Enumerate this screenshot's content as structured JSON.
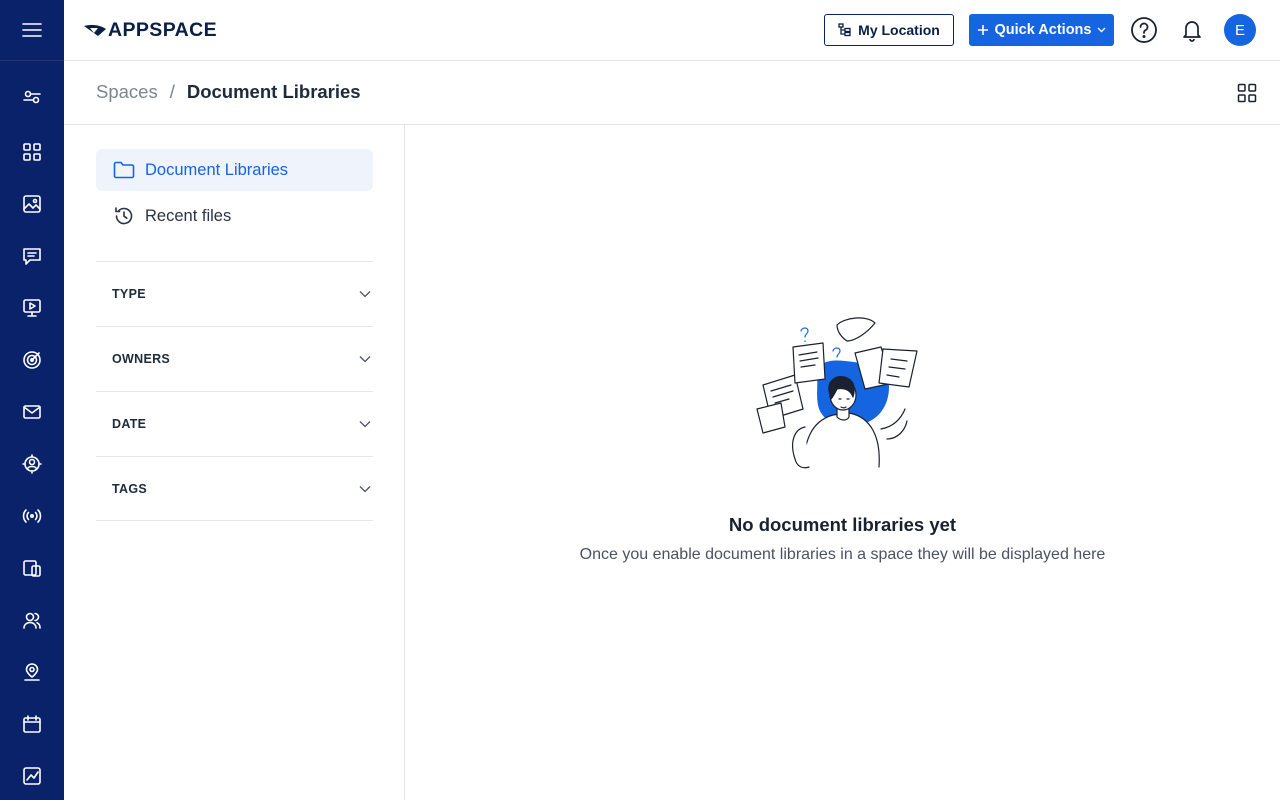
{
  "header": {
    "logo_text": "APPSPACE",
    "my_location_label": "My Location",
    "quick_actions_label": "Quick Actions",
    "avatar_initial": "E"
  },
  "rail": {
    "items": [
      "menu-icon",
      "filters-icon",
      "dashboard-grid-icon",
      "image-icon",
      "messages-icon",
      "display-icon",
      "target-icon",
      "mail-icon",
      "person-location-icon",
      "broadcast-icon",
      "devices-icon",
      "users-icon",
      "map-pin-user-icon",
      "calendar-icon",
      "analytics-icon"
    ]
  },
  "breadcrumb": {
    "parent": "Spaces",
    "separator": "/",
    "current": "Document Libraries"
  },
  "sidebar": {
    "nav": [
      {
        "label": "Document Libraries",
        "active": true
      },
      {
        "label": "Recent files",
        "active": false
      }
    ],
    "filters": [
      "TYPE",
      "OWNERS",
      "DATE",
      "TAGS"
    ]
  },
  "empty_state": {
    "title": "No document libraries yet",
    "subtitle": "Once you enable document libraries in a space they will be displayed here"
  },
  "colors": {
    "rail": "#0a2269",
    "primary": "#1565e0",
    "active_bg": "#eef3fc"
  }
}
